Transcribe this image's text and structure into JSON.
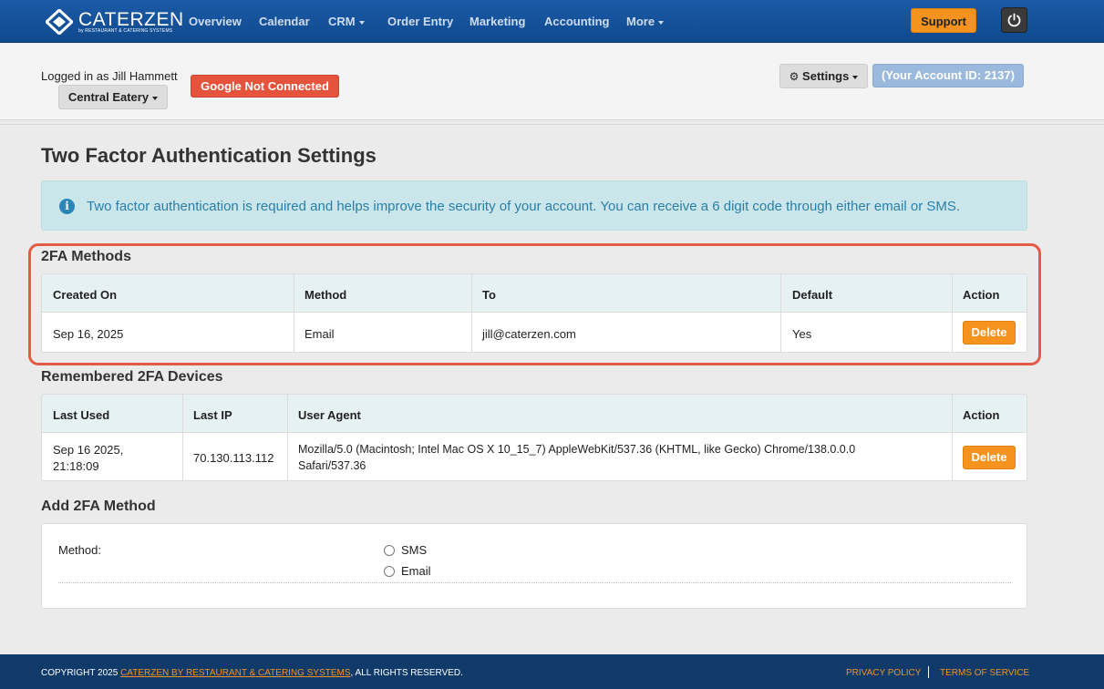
{
  "brand": {
    "name": "CATERZEN",
    "tagline": "by RESTAURANT & CATERING SYSTEMS"
  },
  "nav": {
    "items": [
      {
        "label": "Overview"
      },
      {
        "label": "Calendar"
      },
      {
        "label": "CRM"
      },
      {
        "label": "Order Entry"
      },
      {
        "label": "Marketing"
      },
      {
        "label": "Accounting"
      },
      {
        "label": "More"
      }
    ],
    "support_label": "Support"
  },
  "header": {
    "logged_in": "Logged in as Jill Hammett",
    "venue": "Central Eatery",
    "google_status": "Google Not Connected",
    "settings_label": "Settings",
    "account_id": "(Your Account ID: 2137)"
  },
  "page": {
    "title": "Two Factor Authentication Settings",
    "info": "Two factor authentication is required and helps improve the security of your account. You can receive a 6 digit code through either email or SMS."
  },
  "methods": {
    "title": "2FA Methods",
    "headers": [
      "Created On",
      "Method",
      "To",
      "Default",
      "Action"
    ],
    "rows": [
      {
        "created_on": "Sep 16, 2025",
        "method": "Email",
        "to": "jill@caterzen.com",
        "default": "Yes",
        "action": "Delete"
      }
    ]
  },
  "devices": {
    "title": "Remembered 2FA Devices",
    "headers": [
      "Last Used",
      "Last IP",
      "User Agent",
      "Action"
    ],
    "rows": [
      {
        "last_used_1": "Sep 16 2025,",
        "last_used_2": "21:18:09",
        "ip": "70.130.113.112",
        "agent_1": "Mozilla/5.0 (Macintosh; Intel Mac OS X 10_15_7) AppleWebKit/537.36 (KHTML, like Gecko) Chrome/138.0.0.0",
        "agent_2": "Safari/537.36",
        "action": "Delete"
      }
    ]
  },
  "add_method": {
    "title": "Add 2FA Method",
    "method_label": "Method:",
    "options": [
      "SMS",
      "Email"
    ]
  },
  "footer": {
    "copyright_prefix": "COPYRIGHT 2025 ",
    "company_link": "CATERZEN BY RESTAURANT & CATERING SYSTEMS",
    "copyright_suffix": ", ALL RIGHTS RESERVED.",
    "privacy": "PRIVACY POLICY",
    "terms": "TERMS OF SERVICE"
  },
  "colors": {
    "nav_bg": "#1b5aa6",
    "accent_orange": "#f5931e",
    "danger": "#e5533d",
    "info_bg": "#cbe6ea",
    "footer_bg": "#0f3a6a",
    "highlight": "#e35a45"
  }
}
